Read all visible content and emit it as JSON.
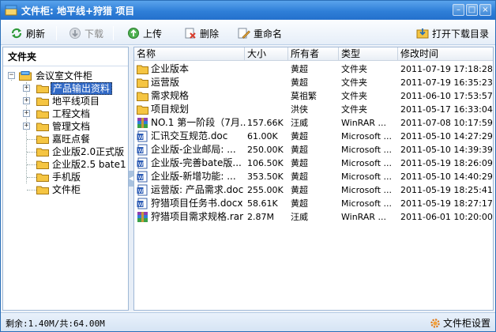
{
  "window": {
    "title": "文件柜: 地平线+狩猎 项目",
    "minimize_glyph": "–",
    "maximize_glyph": "□",
    "close_glyph": "×"
  },
  "toolbar": {
    "refresh_label": "刷新",
    "download_label": "下载",
    "upload_label": "上传",
    "delete_label": "删除",
    "rename_label": "重命名",
    "open_download_dir_label": "打开下载目录"
  },
  "sidebar": {
    "header": "文件夹",
    "root": "会议室文件柜",
    "items": [
      {
        "label": "产品输出资料",
        "expandable": true,
        "selected": true
      },
      {
        "label": "地平线项目",
        "expandable": true,
        "selected": false
      },
      {
        "label": "工程文档",
        "expandable": true,
        "selected": false
      },
      {
        "label": "管理文档",
        "expandable": true,
        "selected": false
      },
      {
        "label": "嘉旺点餐",
        "expandable": false,
        "selected": false
      },
      {
        "label": "企业版2.0正式版",
        "expandable": false,
        "selected": false
      },
      {
        "label": "企业版2.5 bate1",
        "expandable": false,
        "selected": false
      },
      {
        "label": "手机版",
        "expandable": false,
        "selected": false
      },
      {
        "label": "文件柜",
        "expandable": false,
        "selected": false
      }
    ]
  },
  "file_list": {
    "columns": [
      "名称",
      "大小",
      "所有者",
      "类型",
      "修改时间"
    ],
    "rows": [
      {
        "icon": "folder-icon",
        "name": "企业版本",
        "size": "",
        "owner": "黄超",
        "type": "文件夹",
        "modified": "2011-07-19 17:18:28"
      },
      {
        "icon": "folder-icon",
        "name": "运营版",
        "size": "",
        "owner": "黄超",
        "type": "文件夹",
        "modified": "2011-07-19 16:35:23"
      },
      {
        "icon": "folder-icon",
        "name": "需求规格",
        "size": "",
        "owner": "莫祖繁",
        "type": "文件夹",
        "modified": "2011-06-10 17:53:57"
      },
      {
        "icon": "folder-icon",
        "name": "项目规划",
        "size": "",
        "owner": "洪侠",
        "type": "文件夹",
        "modified": "2011-05-17 16:33:04"
      },
      {
        "icon": "rar-icon",
        "name": "NO.1 第一阶段（7月...",
        "size": "157.66K",
        "owner": "汪威",
        "type": "WinRAR ...",
        "modified": "2011-07-08 10:17:59"
      },
      {
        "icon": "word-icon",
        "name": "汇讯交互规范.doc",
        "size": "61.00K",
        "owner": "黄超",
        "type": "Microsoft ...",
        "modified": "2011-05-10 14:27:29"
      },
      {
        "icon": "word-icon",
        "name": "企业版-企业邮局: ...",
        "size": "250.00K",
        "owner": "黄超",
        "type": "Microsoft ...",
        "modified": "2011-05-10 14:39:39"
      },
      {
        "icon": "word-icon",
        "name": "企业版-完善bate版...",
        "size": "106.50K",
        "owner": "黄超",
        "type": "Microsoft ...",
        "modified": "2011-05-19 18:26:09"
      },
      {
        "icon": "word-icon",
        "name": "企业版-新增功能: ...",
        "size": "353.50K",
        "owner": "黄超",
        "type": "Microsoft ...",
        "modified": "2011-05-10 14:40:29"
      },
      {
        "icon": "word-icon",
        "name": "运营版: 产品需求.doc",
        "size": "255.00K",
        "owner": "黄超",
        "type": "Microsoft ...",
        "modified": "2011-05-19 18:25:41"
      },
      {
        "icon": "word-icon",
        "name": "狩猎项目任务书.docx",
        "size": "58.61K",
        "owner": "黄超",
        "type": "Microsoft ...",
        "modified": "2011-05-19 18:27:17"
      },
      {
        "icon": "rar-icon",
        "name": "狩猎项目需求规格.rar",
        "size": "2.87M",
        "owner": "汪威",
        "type": "WinRAR ...",
        "modified": "2011-06-01 10:20:00"
      }
    ]
  },
  "status": {
    "quota": "剩余:1.40M/共:64.00M",
    "settings_label": "文件柜设置"
  },
  "colors": {
    "title_bar": "#2f7fd8",
    "selection": "#3169c6",
    "folder": "#f5c542"
  }
}
